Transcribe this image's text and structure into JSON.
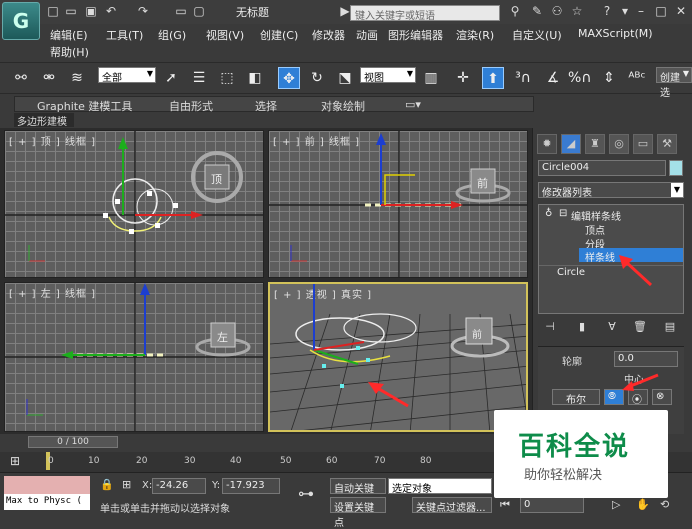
{
  "titlebar": {
    "title": "无标题",
    "search_placeholder": "键入关键字或短语",
    "logo_text": "G"
  },
  "menu": [
    "编辑(E)",
    "工具(T)",
    "组(G)",
    "视图(V)",
    "创建(C)",
    "修改器",
    "动画",
    "图形编辑器",
    "渲染(R)",
    "自定义(U)",
    "MAXScript(M)",
    "帮助(H)"
  ],
  "toolbar": {
    "selection_filter": "全部",
    "reference_coord": "视图",
    "named_selection": "创建选"
  },
  "ribbon": {
    "tabs": [
      "Graphite 建模工具",
      "自由形式",
      "选择",
      "对象绘制"
    ],
    "subtab": "多边形建模"
  },
  "viewports": {
    "top": "[ + ] 顶 ] 线框 ]",
    "front": "[ + ] 前 ] 线框 ]",
    "left": "[ + ] 左 ] 线框 ]",
    "perspective": "[ + ] 透视 ] 真实 ]",
    "viewcube_top": "顶",
    "viewcube_front": "前",
    "viewcube_left": "左",
    "viewcube_persp": "前"
  },
  "command_panel": {
    "object_name": "Circle004",
    "object_color": "#a4e0e8",
    "modifier_list": "修改器列表",
    "stack": {
      "modifier": "编辑样条线",
      "sub_vertex": "顶点",
      "sub_segment": "分段",
      "sub_spline": "样条线",
      "base": "Circle"
    },
    "rollout": {
      "outline_label": "轮廓",
      "outline_value": "0.0",
      "center_label": "中心",
      "boolean_label": "布尔"
    }
  },
  "timeline": {
    "slider": "0 / 100",
    "ticks": [
      "0",
      "10",
      "20",
      "30",
      "40",
      "50",
      "60",
      "70",
      "80"
    ]
  },
  "status": {
    "maxscript": "Max to Physc (",
    "x_label": "X:",
    "x_value": "-24.26",
    "y_label": "Y:",
    "y_value": "-17.923",
    "prompt": "单击或单击并拖动以选择对象",
    "autokey": "自动关键点",
    "setkey": "设置关键点",
    "selected_object": "选定对象",
    "key_filter": "关键点过滤器...",
    "frame": "0"
  },
  "watermark": {
    "line1": "百科全说",
    "line2": "助你轻松解决"
  },
  "colors": {
    "active_viewport_border": "#d2c25a",
    "selection_highlight": "#2f7fd6",
    "annotation_arrow": "#ff2a2a",
    "watermark_green": "#0e8c4a"
  }
}
